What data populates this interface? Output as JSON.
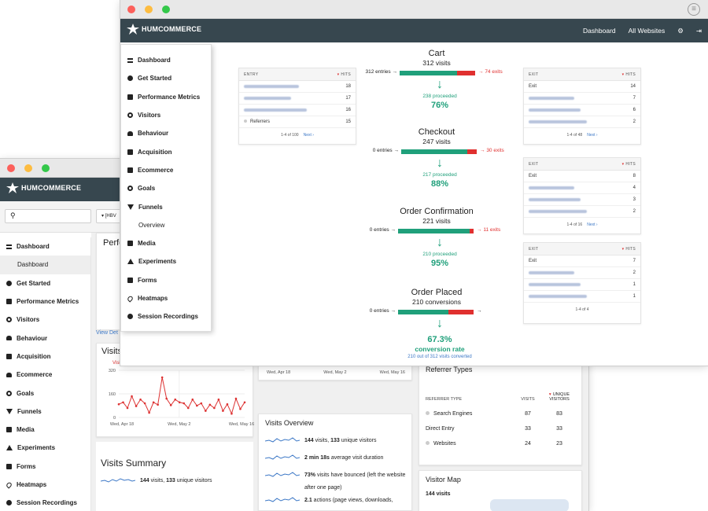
{
  "back_window": {
    "brand": "HUMCOMMERCE",
    "site_selector": "[HBV",
    "sidebar": [
      {
        "label": "Dashboard",
        "icon": "lines-icon"
      },
      {
        "label": "Dashboard",
        "sub": true
      },
      {
        "label": "Get Started",
        "icon": "circle-icon"
      },
      {
        "label": "Performance Metrics",
        "icon": "grid-icon"
      },
      {
        "label": "Visitors",
        "icon": "eye-icon"
      },
      {
        "label": "Behaviour",
        "icon": "bell-icon"
      },
      {
        "label": "Acquisition",
        "icon": "calendar-icon"
      },
      {
        "label": "Ecommerce",
        "icon": "cart-icon"
      },
      {
        "label": "Goals",
        "icon": "target-icon"
      },
      {
        "label": "Funnels",
        "icon": "funnel-icon"
      },
      {
        "label": "Media",
        "icon": "folder-icon"
      },
      {
        "label": "Experiments",
        "icon": "flask-icon"
      },
      {
        "label": "Forms",
        "icon": "form-icon"
      },
      {
        "label": "Heatmaps",
        "icon": "drop-icon"
      },
      {
        "label": "Session Recordings",
        "icon": "record-icon"
      }
    ],
    "perf_title": "Perfo",
    "view_link": "View Det",
    "visits_chart": {
      "title": "Visits",
      "legend": "Visits",
      "yticks": [
        "320",
        "160",
        "0"
      ],
      "xticks": [
        "Wed, Apr 18",
        "Wed, May 2",
        "Wed, May 16"
      ]
    },
    "middle_chart_xticks": [
      "Wed, Apr 18",
      "Wed, May 2",
      "Wed, May 16"
    ],
    "visits_summary": {
      "title": "Visits Summary",
      "line1_bold_a": "144",
      "line1_mid": " visits, ",
      "line1_bold_b": "133",
      "line1_tail": " unique visitors"
    },
    "visits_overview": {
      "title": "Visits Overview",
      "rows": [
        {
          "bold": "144",
          "text": " visits, ",
          "bold2": "133",
          "text2": " unique visitors"
        },
        {
          "bold": "2 min 18s",
          "text": " average visit duration",
          "bold2": "",
          "text2": ""
        },
        {
          "bold": "73%",
          "text": " visits have bounced (left the website",
          "bold2": "",
          "text2": ""
        },
        {
          "bold": "",
          "text": "after one page)",
          "bold2": "",
          "text2": ""
        },
        {
          "bold": "2.1",
          "text": " actions (page views, downloads,",
          "bold2": "",
          "text2": ""
        }
      ]
    },
    "referrer_types": {
      "title": "Referrer Types",
      "col1": "REFERRER TYPE",
      "col2": "VISITS",
      "col3": "UNIQUE VISITORS",
      "rows": [
        {
          "name": "Search Engines",
          "visits": "87",
          "unique": "83"
        },
        {
          "name": "Direct Entry",
          "visits": "33",
          "unique": "33"
        },
        {
          "name": "Websites",
          "visits": "24",
          "unique": "23"
        }
      ]
    },
    "visitor_map": {
      "title": "Visitor Map",
      "text": "144 visits"
    }
  },
  "front_window": {
    "brand": "HUMCOMMERCE",
    "nav": {
      "dashboard": "Dashboard",
      "all_websites": "All Websites"
    },
    "menu": [
      "Dashboard",
      "Get Started",
      "Performance Metrics",
      "Visitors",
      "Behaviour",
      "Acquisition",
      "Ecommerce",
      "Goals",
      "Funnels",
      "Overview",
      "Media",
      "Experiments",
      "Forms",
      "Heatmaps",
      "Session Recordings"
    ],
    "entry_table": {
      "col1": "ENTRY",
      "col2": "HITS",
      "rows": [
        {
          "v": "18"
        },
        {
          "v": "17"
        },
        {
          "v": "16"
        }
      ],
      "referrers_label": "Referrers",
      "referrers_value": "15",
      "footer": "1-4 of 100",
      "next": "Next ›"
    },
    "exit_tables": [
      {
        "col1": "EXIT",
        "col2": "HITS",
        "first_label": "Exit",
        "values": [
          "14",
          "7",
          "6",
          "2"
        ],
        "footer": "1-4 of 48",
        "next": "Next ›"
      },
      {
        "col1": "EXIT",
        "col2": "HITS",
        "first_label": "Exit",
        "values": [
          "8",
          "4",
          "3",
          "2"
        ],
        "footer": "1-4 of 16",
        "next": "Next ›"
      },
      {
        "col1": "EXIT",
        "col2": "HITS",
        "first_label": "Exit",
        "values": [
          "7",
          "2",
          "1",
          "1"
        ],
        "footer": "1-4 of 4",
        "next": ""
      }
    ],
    "funnel": [
      {
        "title": "Cart",
        "visits": "312 visits",
        "entries": "312 entries",
        "exits": "74 exits",
        "proceeded": "238 proceeded",
        "rate": "76%",
        "green_fraction": 0.76
      },
      {
        "title": "Checkout",
        "visits": "247 visits",
        "entries": "0 entries",
        "exits": "30 exits",
        "proceeded": "217 proceeded",
        "rate": "88%",
        "green_fraction": 0.88
      },
      {
        "title": "Order Confirmation",
        "visits": "221 visits",
        "entries": "0 entries",
        "exits": "11 exits",
        "proceeded": "210 proceeded",
        "rate": "95%",
        "green_fraction": 0.95
      },
      {
        "title": "Order Placed",
        "visits": "210 conversions",
        "entries": "0 entries",
        "exits": "",
        "proceeded": "",
        "rate": "",
        "green_fraction": 0.67
      }
    ],
    "conversion": {
      "rate": "67.3%",
      "label": "conversion rate",
      "detail": "210 out of 312 visits converted"
    }
  }
}
